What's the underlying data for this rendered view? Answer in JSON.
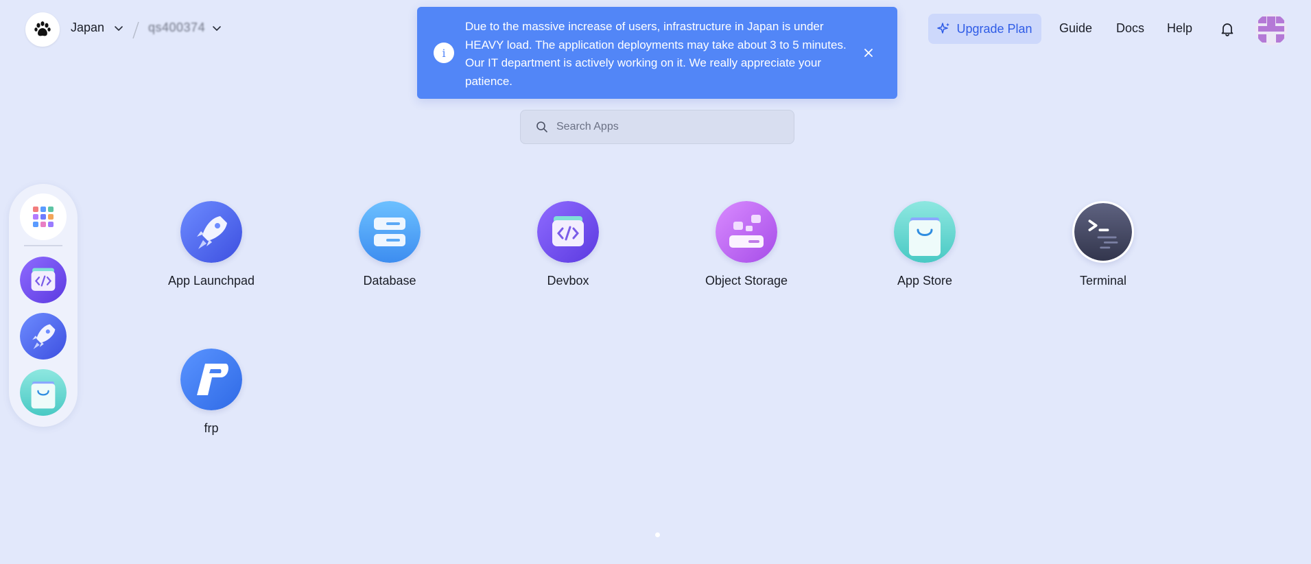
{
  "topbar": {
    "region": "Japan",
    "workspace_id": "qs400374",
    "upgrade_label": "Upgrade Plan",
    "links": [
      "Guide",
      "Docs",
      "Help"
    ]
  },
  "notice": {
    "text": "Due to the massive increase of users, infrastructure in Japan is under HEAVY load. The application deployments may take about 3 to 5 minutes. Our IT department is actively working on it. We really appreciate your patience.",
    "info_glyph": "i"
  },
  "search": {
    "placeholder": "Search Apps"
  },
  "apps": [
    {
      "label": "App Launchpad",
      "icon": "rocket-icon"
    },
    {
      "label": "Database",
      "icon": "database-icon"
    },
    {
      "label": "Devbox",
      "icon": "devbox-icon"
    },
    {
      "label": "Object Storage",
      "icon": "object-storage-icon"
    },
    {
      "label": "App Store",
      "icon": "shopping-bag-icon"
    },
    {
      "label": "Terminal",
      "icon": "terminal-icon"
    },
    {
      "label": "frp",
      "icon": "frp-icon"
    }
  ],
  "dock": [
    "all-apps-icon",
    "devbox-icon",
    "rocket-icon",
    "shopping-bag-icon"
  ],
  "colors": {
    "background": "#e2e8fb",
    "notice": "#5286f7",
    "accent": "#2f5ce6",
    "upgrade_bg": "#cdd8fb"
  }
}
